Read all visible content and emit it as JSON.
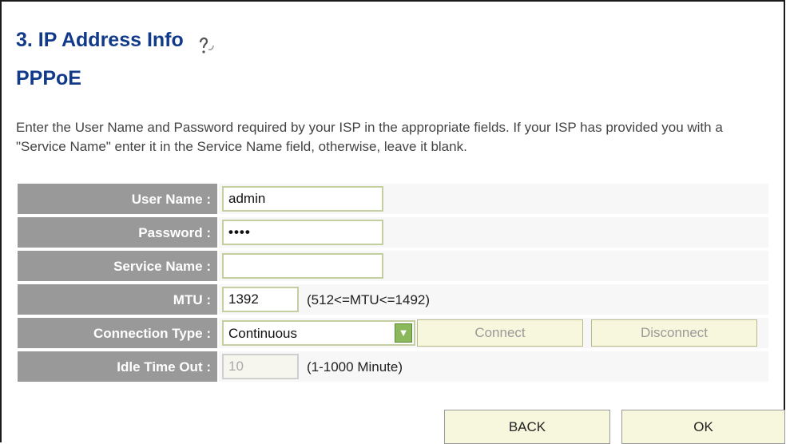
{
  "page": {
    "title": "3. IP Address Info",
    "subtitle": "PPPoE",
    "description": "Enter the User Name and Password required by your ISP in the appropriate fields. If your ISP has provided you with a \"Service Name\" enter it in the Service Name field, otherwise, leave it blank."
  },
  "form": {
    "user_name_label": "User Name :",
    "user_name_value": "admin",
    "password_label": "Password :",
    "password_value": "••••",
    "service_name_label": "Service Name :",
    "service_name_value": "",
    "mtu_label": "MTU :",
    "mtu_value": "1392",
    "mtu_hint": "(512<=MTU<=1492)",
    "connection_type_label": "Connection Type :",
    "connection_type_value": "Continuous",
    "connect_label": "Connect",
    "disconnect_label": "Disconnect",
    "idle_timeout_label": "Idle Time Out :",
    "idle_timeout_value": "10",
    "idle_timeout_hint": "(1-1000 Minute)"
  },
  "footer": {
    "back_label": "BACK",
    "ok_label": "OK"
  },
  "icons": {
    "help": "help-icon",
    "dropdown": "chevron-down-icon"
  },
  "colors": {
    "title": "#123a8a",
    "label_bg": "#999999",
    "input_border": "#c3cfa0",
    "button_bg": "#f7f7de",
    "dropdown_arrow": "#8ab85a"
  }
}
